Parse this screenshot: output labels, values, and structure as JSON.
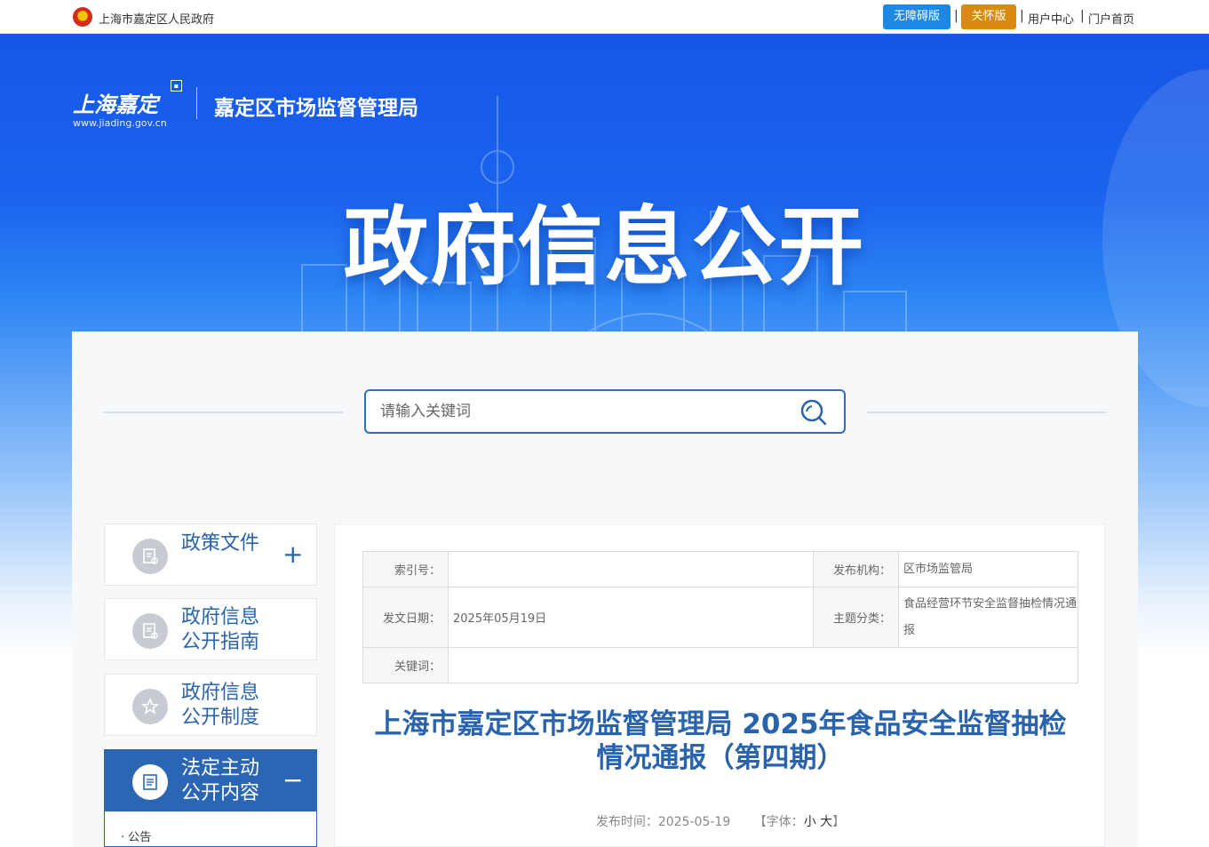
{
  "topbar": {
    "gov_name": "上海市嘉定区人民政府",
    "accessible_label": "无障碍版",
    "care_label": "关怀版",
    "separator": "|",
    "user_center": "用户中心",
    "portal_home": "门户首页"
  },
  "header": {
    "logo_text": "上海嘉定",
    "logo_url": "www.jiading.gov.cn",
    "bureau": "嘉定区市场监督管理局",
    "hero_title": "政府信息公开"
  },
  "search": {
    "placeholder": "请输入关键词"
  },
  "sidebar": {
    "items": [
      {
        "label": "政策文件",
        "toggle": "+"
      },
      {
        "label_line1": "政府信息",
        "label_line2": "公开指南"
      },
      {
        "label_line1": "政府信息",
        "label_line2": "公开制度"
      },
      {
        "label_line1": "法定主动",
        "label_line2": "公开内容",
        "toggle": "−"
      }
    ],
    "sub_items": [
      "· 公告"
    ]
  },
  "article": {
    "meta": {
      "index_key": "索引号：",
      "index_value": "",
      "publisher_key": "发布机构：",
      "publisher_value": "区市场监管局",
      "date_key": "发文日期：",
      "date_value": "2025年05月19日",
      "topic_key": "主题分类：",
      "topic_value": "食品经营环节安全监督抽检情况通报",
      "keyword_key": "关键词：",
      "keyword_value": ""
    },
    "title": "上海市嘉定区市场监督管理局 2025年食品安全监督抽检情况通报（第四期）",
    "publish_time": "发布时间：2025-05-19",
    "font_label_open": "【字体：",
    "font_small": "小",
    "font_large": "大",
    "font_label_close": "】"
  },
  "colors": {
    "primary_blue": "#2a63ad",
    "banner_blue": "#1756e6",
    "accessible_btn": "#1e88e5",
    "care_btn": "#d88a12"
  }
}
